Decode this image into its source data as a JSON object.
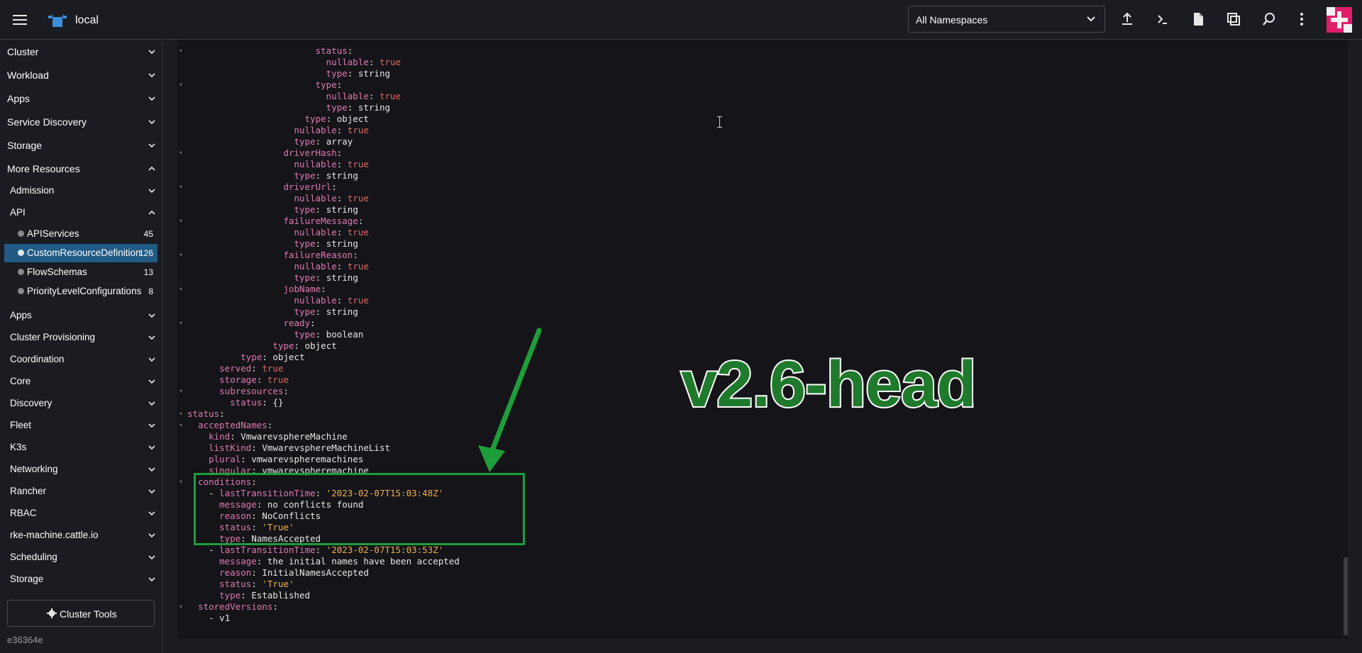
{
  "header": {
    "cluster_name": "local",
    "namespace_select": "All Namespaces"
  },
  "sidebar": {
    "groups_top": [
      {
        "label": "Cluster"
      },
      {
        "label": "Workload"
      },
      {
        "label": "Apps"
      },
      {
        "label": "Service Discovery"
      },
      {
        "label": "Storage"
      },
      {
        "label": "More Resources"
      }
    ],
    "sub_admission": "Admission",
    "sub_api": "API",
    "api_items": [
      {
        "label": "APIServices",
        "count": "45"
      },
      {
        "label": "CustomResourceDefinition",
        "count": "126"
      },
      {
        "label": "FlowSchemas",
        "count": "13"
      },
      {
        "label": "PriorityLevelConfigurations",
        "count": "8"
      }
    ],
    "sub_groups": [
      {
        "label": "Apps"
      },
      {
        "label": "Cluster Provisioning"
      },
      {
        "label": "Coordination"
      },
      {
        "label": "Core"
      },
      {
        "label": "Discovery"
      },
      {
        "label": "Fleet"
      },
      {
        "label": "K3s"
      },
      {
        "label": "Networking"
      },
      {
        "label": "Rancher"
      },
      {
        "label": "RBAC"
      },
      {
        "label": "rke-machine.cattle.io"
      },
      {
        "label": "Scheduling"
      },
      {
        "label": "Storage"
      }
    ],
    "cluster_tools": "Cluster Tools",
    "version": "e36364e"
  },
  "editor": {
    "lines": [
      {
        "indent": 12,
        "key": "status",
        "fold": true
      },
      {
        "indent": 13,
        "key": "nullable",
        "val": "true",
        "vt": "b"
      },
      {
        "indent": 13,
        "key": "type",
        "val": "string",
        "vt": "v"
      },
      {
        "indent": 12,
        "key": "type",
        "fold": true
      },
      {
        "indent": 13,
        "key": "nullable",
        "val": "true",
        "vt": "b"
      },
      {
        "indent": 13,
        "key": "type",
        "val": "string",
        "vt": "v"
      },
      {
        "indent": 11,
        "key": "type",
        "val": "object",
        "vt": "v"
      },
      {
        "indent": 10,
        "key": "nullable",
        "val": "true",
        "vt": "b"
      },
      {
        "indent": 10,
        "key": "type",
        "val": "array",
        "vt": "v"
      },
      {
        "indent": 9,
        "key": "driverHash",
        "fold": true
      },
      {
        "indent": 10,
        "key": "nullable",
        "val": "true",
        "vt": "b"
      },
      {
        "indent": 10,
        "key": "type",
        "val": "string",
        "vt": "v"
      },
      {
        "indent": 9,
        "key": "driverUrl",
        "fold": true
      },
      {
        "indent": 10,
        "key": "nullable",
        "val": "true",
        "vt": "b"
      },
      {
        "indent": 10,
        "key": "type",
        "val": "string",
        "vt": "v"
      },
      {
        "indent": 9,
        "key": "failureMessage",
        "fold": true
      },
      {
        "indent": 10,
        "key": "nullable",
        "val": "true",
        "vt": "b"
      },
      {
        "indent": 10,
        "key": "type",
        "val": "string",
        "vt": "v"
      },
      {
        "indent": 9,
        "key": "failureReason",
        "fold": true
      },
      {
        "indent": 10,
        "key": "nullable",
        "val": "true",
        "vt": "b"
      },
      {
        "indent": 10,
        "key": "type",
        "val": "string",
        "vt": "v"
      },
      {
        "indent": 9,
        "key": "jobName",
        "fold": true
      },
      {
        "indent": 10,
        "key": "nullable",
        "val": "true",
        "vt": "b"
      },
      {
        "indent": 10,
        "key": "type",
        "val": "string",
        "vt": "v"
      },
      {
        "indent": 9,
        "key": "ready",
        "fold": true
      },
      {
        "indent": 10,
        "key": "type",
        "val": "boolean",
        "vt": "v"
      },
      {
        "indent": 8,
        "key": "type",
        "val": "object",
        "vt": "v"
      },
      {
        "indent": 5,
        "key": "type",
        "val": "object",
        "vt": "v"
      },
      {
        "indent": 3,
        "key": "served",
        "val": "true",
        "vt": "b"
      },
      {
        "indent": 3,
        "key": "storage",
        "val": "true",
        "vt": "b"
      },
      {
        "indent": 3,
        "key": "subresources",
        "fold": true
      },
      {
        "indent": 4,
        "key": "status",
        "val": "{}",
        "vt": "v"
      },
      {
        "indent": 0,
        "key": "status",
        "fold": true
      },
      {
        "indent": 1,
        "key": "acceptedNames",
        "fold": true
      },
      {
        "indent": 2,
        "key": "kind",
        "val": "VmwarevsphereMachine",
        "vt": "v"
      },
      {
        "indent": 2,
        "key": "listKind",
        "val": "VmwarevsphereMachineList",
        "vt": "v"
      },
      {
        "indent": 2,
        "key": "plural",
        "val": "vmwarevspheremachines",
        "vt": "v"
      },
      {
        "indent": 2,
        "key": "singular",
        "val": "vmwarevspheremachine",
        "vt": "v"
      },
      {
        "indent": 1,
        "key": "conditions",
        "fold": true
      },
      {
        "indent": 2,
        "dash": true,
        "key": "lastTransitionTime",
        "val": "'2023-02-07T15:03:48Z'",
        "vt": "s"
      },
      {
        "indent": 3,
        "key": "message",
        "val": "no conflicts found",
        "vt": "v"
      },
      {
        "indent": 3,
        "key": "reason",
        "val": "NoConflicts",
        "vt": "v"
      },
      {
        "indent": 3,
        "key": "status",
        "val": "'True'",
        "vt": "s"
      },
      {
        "indent": 3,
        "key": "type",
        "val": "NamesAccepted",
        "vt": "v"
      },
      {
        "indent": 2,
        "dash": true,
        "key": "lastTransitionTime",
        "val": "'2023-02-07T15:03:53Z'",
        "vt": "s"
      },
      {
        "indent": 3,
        "key": "message",
        "val": "the initial names have been accepted",
        "vt": "v"
      },
      {
        "indent": 3,
        "key": "reason",
        "val": "InitialNamesAccepted",
        "vt": "v"
      },
      {
        "indent": 3,
        "key": "status",
        "val": "'True'",
        "vt": "s"
      },
      {
        "indent": 3,
        "key": "type",
        "val": "Established",
        "vt": "v"
      },
      {
        "indent": 1,
        "key": "storedVersions",
        "fold": true
      },
      {
        "indent": 2,
        "dash": true,
        "plain": "v1"
      }
    ]
  },
  "overlay": {
    "watermark": "v2.6-head"
  }
}
